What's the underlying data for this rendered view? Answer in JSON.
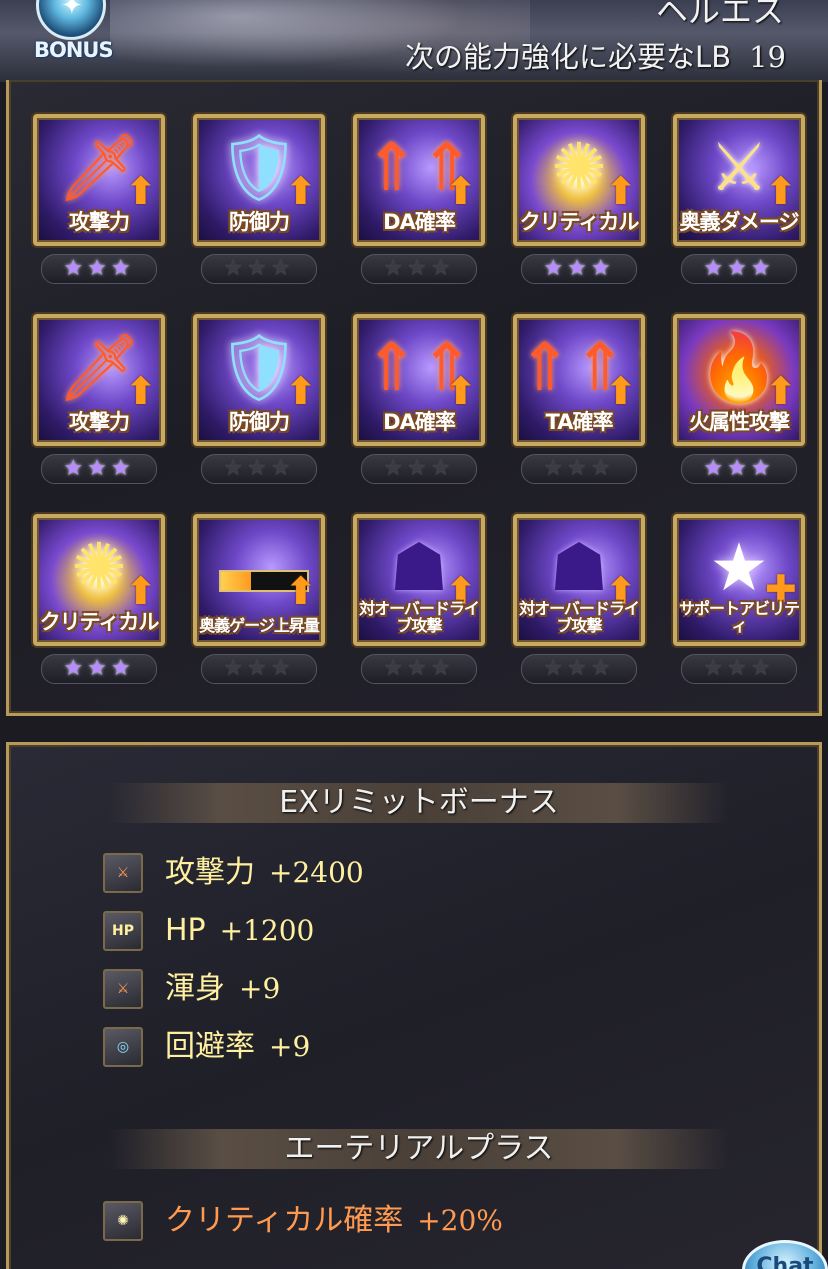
{
  "header": {
    "bonus_label": "BONUS",
    "character_name": "ヘルエス",
    "next_lb_text": "次の能力強化に必要なLB",
    "next_lb_value": "19"
  },
  "grid": [
    [
      {
        "name": "攻撃力",
        "glyph": "🗡",
        "stars": "★★★",
        "active": true
      },
      {
        "name": "防御力",
        "glyph": "🛡",
        "stars": "★★★",
        "active": false
      },
      {
        "name": "DA確率",
        "glyph": "⇑⇑",
        "stars": "★★★",
        "active": false
      },
      {
        "name": "クリティカル",
        "glyph": "✺",
        "stars": "★★★",
        "active": true
      },
      {
        "name": "奥義ダメージ",
        "glyph": "⚔",
        "stars": "★★★",
        "active": true
      }
    ],
    [
      {
        "name": "攻撃力",
        "glyph": "🗡",
        "stars": "★★★",
        "active": true
      },
      {
        "name": "防御力",
        "glyph": "🛡",
        "stars": "★★★",
        "active": false
      },
      {
        "name": "DA確率",
        "glyph": "⇑⇑",
        "stars": "★★★",
        "active": false
      },
      {
        "name": "TA確率",
        "glyph": "⇑⇑⇑",
        "stars": "★★★",
        "active": false
      },
      {
        "name": "火属性攻撃",
        "glyph": "🔥",
        "stars": "★★★",
        "active": true
      }
    ],
    [
      {
        "name": "クリティカル",
        "glyph": "✺",
        "stars": "★★★",
        "active": true
      },
      {
        "name": "奥義ゲージ上昇量",
        "glyph": "",
        "stars": "★★★",
        "active": false
      },
      {
        "name": "対オーバードライブ攻撃",
        "glyph": "☗",
        "stars": "★★★",
        "active": false
      },
      {
        "name": "対オーバードライブ攻撃",
        "glyph": "☗",
        "stars": "★★★",
        "active": false
      },
      {
        "name": "サポートアビリティ",
        "glyph": "★",
        "stars": "★★★",
        "active": false
      }
    ]
  ],
  "ex_limit_bonus": {
    "title": "EXリミットボーナス",
    "items": [
      {
        "icon": "sword-icon",
        "icon_text": "⚔",
        "name": "攻撃力",
        "value": "+2400"
      },
      {
        "icon": "hp-icon",
        "icon_text": "HP",
        "name": "HP",
        "value": "+1200"
      },
      {
        "icon": "sword-icon",
        "icon_text": "⚔",
        "name": "渾身",
        "value": "+9"
      },
      {
        "icon": "shield-icon",
        "icon_text": "◎",
        "name": "回避率",
        "value": "+9"
      }
    ]
  },
  "ethereal_plus": {
    "title": "エーテリアルプラス",
    "items": [
      {
        "icon": "critical-icon",
        "icon_text": "✺",
        "name": "クリティカル確率",
        "value": "+20%"
      }
    ]
  },
  "chat_button": {
    "label": "Chat"
  }
}
